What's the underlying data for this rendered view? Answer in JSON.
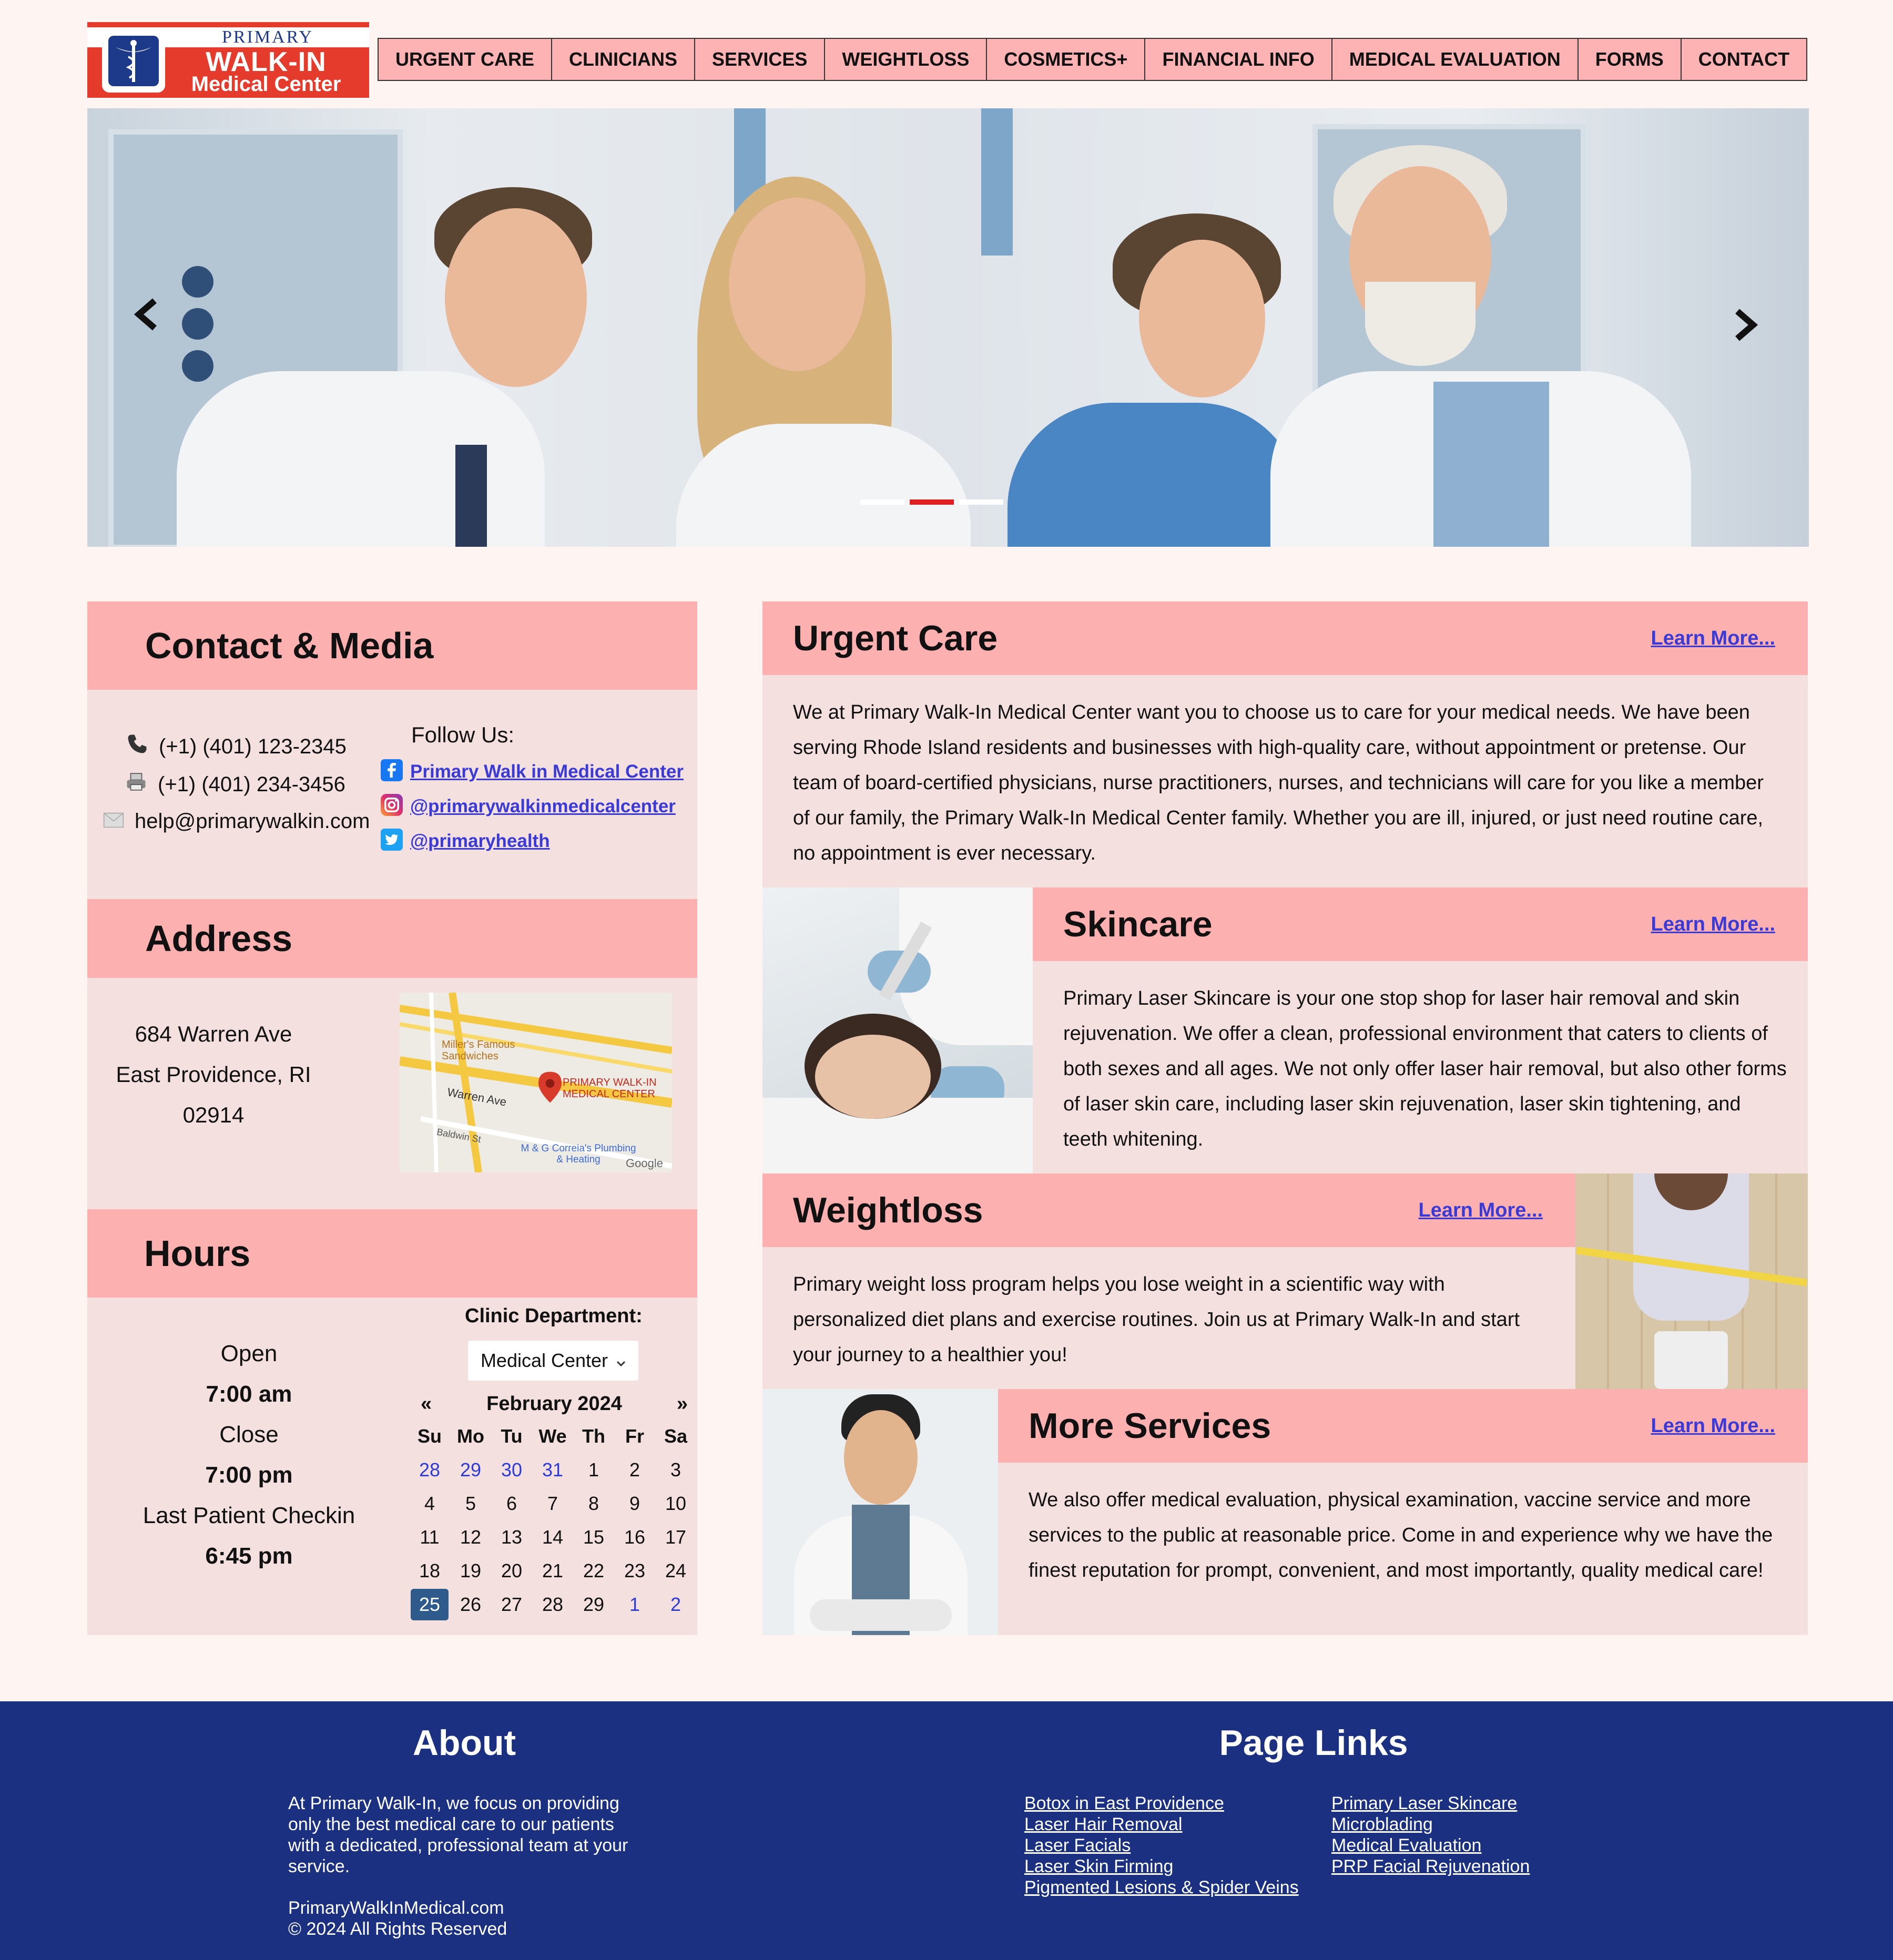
{
  "logo": {
    "primary": "PRIMARY",
    "walkin": "WALK-IN",
    "subtitle": "Medical Center"
  },
  "nav": {
    "items": [
      "URGENT CARE",
      "CLINICIANS",
      "SERVICES",
      "WEIGHTLOSS",
      "COSMETICS+",
      "FINANCIAL INFO",
      "MEDICAL EVALUATION",
      "FORMS",
      "CONTACT"
    ]
  },
  "hero": {
    "prev_icon": "chevron-left-icon",
    "next_icon": "chevron-right-icon",
    "slides": 3,
    "active_slide": 2,
    "active_color": "#e02020"
  },
  "contact": {
    "title": "Contact & Media",
    "phone": "(+1) (401) 123-2345",
    "fax": "(+1) (401) 234-3456",
    "email": "help@primarywalkin.com",
    "follow_label": "Follow Us:",
    "facebook": "Primary Walk in Medical Center",
    "instagram": "@primarywalkinmedicalcenter",
    "twitter": "@primaryhealth"
  },
  "address": {
    "title": "Address",
    "line1": "684 Warren Ave",
    "line2": "East Providence, RI",
    "line3": "02914",
    "map": {
      "place1": "Miller's Famous Sandwiches",
      "place_main": "PRIMARY WALK-IN MEDICAL CENTER",
      "street1": "Warren Ave",
      "street2": "Baldwin St",
      "place3": "M & G Correia's Plumbing & Heating",
      "brand": "Google"
    }
  },
  "hours": {
    "title": "Hours",
    "open_label": "Open",
    "open_time": "7:00 am",
    "close_label": "Close",
    "close_time": "7:00 pm",
    "last_label": "Last Patient Checkin",
    "last_time": "6:45 pm",
    "dept_label": "Clinic Department:",
    "dept_value": "Medical Center",
    "calendar": {
      "prev": "«",
      "next": "»",
      "month": "February 2024",
      "weekdays": [
        "Su",
        "Mo",
        "Tu",
        "We",
        "Th",
        "Fr",
        "Sa"
      ],
      "weeks": [
        [
          "28",
          "29",
          "30",
          "31",
          "1",
          "2",
          "3"
        ],
        [
          "4",
          "5",
          "6",
          "7",
          "8",
          "9",
          "10"
        ],
        [
          "11",
          "12",
          "13",
          "14",
          "15",
          "16",
          "17"
        ],
        [
          "18",
          "19",
          "20",
          "21",
          "22",
          "23",
          "24"
        ],
        [
          "25",
          "26",
          "27",
          "28",
          "29",
          "1",
          "2"
        ]
      ],
      "today": "25"
    }
  },
  "services": {
    "urgent": {
      "title": "Urgent Care",
      "learn": "Learn More...",
      "text": "We at Primary Walk-In Medical Center want you to choose us to care for your medical needs. We have been serving Rhode Island residents and businesses with high-quality care, without appointment or pretense. Our team of board-certified physicians, nurse practitioners, nurses, and technicians will care for you like a member of our family, the Primary Walk-In Medical Center family. Whether you are ill, injured, or just need routine care, no appointment is ever necessary."
    },
    "skincare": {
      "title": "Skincare",
      "learn": "Learn More...",
      "text": "Primary Laser Skincare is your one stop shop for laser hair removal and skin rejuvenation. We offer a clean, professional environment that caters to clients of both sexes and all ages. We not only offer laser hair removal, but also other forms of laser skin care, including laser skin rejuvenation, laser skin tightening, and teeth whitening."
    },
    "weightloss": {
      "title": "Weightloss",
      "learn": "Learn More...",
      "text": "Primary weight loss program helps you lose weight in a scientific way with personalized diet plans and exercise routines. Join us at Primary Walk-In and start your journey to a healthier you!"
    },
    "more": {
      "title": "More Services",
      "learn": "Learn More...",
      "text": "We also offer medical evaluation, physical examination, vaccine service and more services to the public at reasonable price. Come in and experience why we have the finest reputation for prompt, convenient, and most importantly, quality medical care!"
    }
  },
  "footer": {
    "about_title": "About",
    "about_text": "At Primary Walk-In, we focus on providing only the best medical care to our patients with a dedicated, professional team at your service.",
    "site": "PrimaryWalkInMedical.com",
    "copyright": "© 2024 All Rights Reserved",
    "links_title": "Page Links",
    "links_col1": [
      "Botox in East Providence",
      "Laser Hair Removal",
      "Laser Facials",
      "Laser Skin Firming",
      "Pigmented Lesions & Spider Veins"
    ],
    "links_col2": [
      "Primary Laser Skincare",
      "Microblading",
      "Medical Evaluation",
      "PRP Facial Rejuvenation"
    ]
  },
  "colors": {
    "header_pink": "#fdb0b0",
    "panel_pink": "#f5e0e0",
    "footer_blue": "#1b3080",
    "link_blue": "#3a3ad6",
    "logo_red": "#e53b2c"
  }
}
